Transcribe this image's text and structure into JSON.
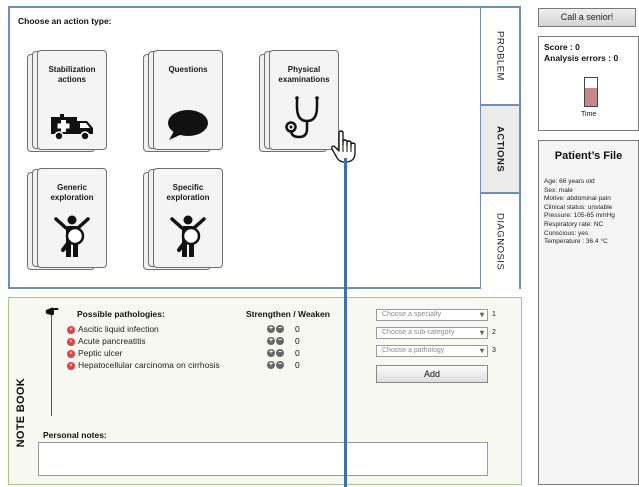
{
  "actions": {
    "heading": "Choose an action type:",
    "cards": [
      {
        "title": "Stabilization actions",
        "icon": "ambulance-icon"
      },
      {
        "title": "Questions",
        "icon": "speech-bubble-icon"
      },
      {
        "title": "Physical examinations",
        "icon": "stethoscope-icon"
      },
      {
        "title": "Generic exploration",
        "icon": "magnifier-person-icon"
      },
      {
        "title": "Specific exploration",
        "icon": "magnifier-person-icon"
      }
    ]
  },
  "tabs": [
    {
      "label": "PROBLEM",
      "active": false
    },
    {
      "label": "ACTIONS",
      "active": true
    },
    {
      "label": "DIAGNOSIS",
      "active": false
    }
  ],
  "call_button": "Call a senior!",
  "score": {
    "score_line": "Score : 0",
    "errors_line": "Analysis errors : 0",
    "time_label": "Time",
    "time_remaining": 0.65
  },
  "patient": {
    "title": "Patient’s File",
    "details": [
      "Age:  66 years old",
      "Sex: male",
      "Motive: abdominal pain",
      "Clinical status: unstable",
      "Pressure: 105-65 mmHg",
      "Respiratory rate: NC",
      "Conscious: yes",
      "Temperature : 36.4 °C"
    ]
  },
  "notebook": {
    "label": "NOTE BOOK",
    "pathologies_heading": "Possible pathologies:",
    "strengthen_heading": "Strengthen / Weaken",
    "pathologies": [
      {
        "name": "Ascitic liquid infection",
        "count": "0"
      },
      {
        "name": "Acute pancreatitis",
        "count": "0"
      },
      {
        "name": "Peptic ulcer",
        "count": "0"
      },
      {
        "name": "Hepatocellular carcinoma on cirrhosis",
        "count": "0"
      }
    ],
    "selects": [
      {
        "placeholder": "Choose a specialty",
        "num": "1"
      },
      {
        "placeholder": "Choose a sub-category",
        "num": "2"
      },
      {
        "placeholder": "Choose a pathology",
        "num": "3"
      }
    ],
    "add_label": "Add",
    "notes_label": "Personal notes:",
    "notes_value": ""
  },
  "colors": {
    "panel_border": "#6d8fb8",
    "notebook_border": "#a9c58b",
    "timer_fill": "#c9878b",
    "drag_line": "#3f6fae",
    "remove_red": "#e04040"
  }
}
